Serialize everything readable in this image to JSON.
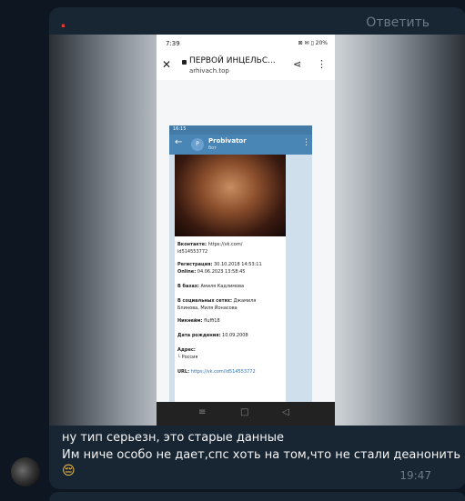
{
  "previous_message": {
    "sender_mark": ".",
    "reply_label": "Ответить"
  },
  "screenshot": {
    "phone": {
      "time": "7:39",
      "status_icons": "⊠ ✉ ▯ 20%",
      "page_title": "ПЕРВОЙ ИНЦЕЛЬС...",
      "url": "arhivach.top"
    },
    "telegram": {
      "time": "16:15",
      "bot_name": "Probivator",
      "bot_sub": "бот",
      "avatar_letter": "P",
      "lines": [
        {
          "label": "Вконтакте:",
          "value": "https://vk.com/"
        },
        {
          "label": "",
          "value": "id514553772"
        },
        {
          "label": "Регистрация:",
          "value": "30.10.2018 14:53:11"
        },
        {
          "label": "Online:",
          "value": "04.06.2023 13:58:45"
        },
        {
          "label": "В базах:",
          "value": "Амиля Кадлимова"
        },
        {
          "label": "В социальных сетях:",
          "value": "Джамиля"
        },
        {
          "label": "",
          "value": "Блинова, Миля Йонасова"
        },
        {
          "label": "Никнейм:",
          "value": "fluffi18"
        },
        {
          "label": "Дата рождения:",
          "value": "10.09.2008"
        },
        {
          "label": "Адрес:",
          "value": ""
        },
        {
          "label": "",
          "value": "└ Россия"
        },
        {
          "label": "URL:",
          "value": "https://vk.com/id514553772"
        }
      ]
    }
  },
  "message": {
    "line1": "ну тип серьезн, это старые данные",
    "line2": "Им ниче особо не дает,спс хоть на том,что не стали деанонить",
    "emoji": "😔",
    "time": "19:47"
  }
}
